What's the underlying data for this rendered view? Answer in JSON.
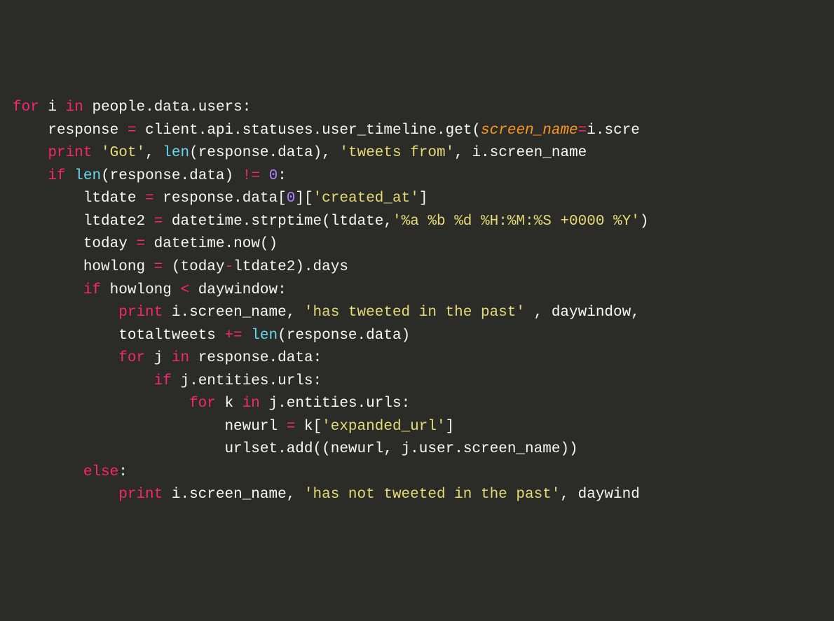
{
  "code": {
    "l1": {
      "kw1": "for",
      "kw2": "in",
      "id1": "i",
      "id2": "people",
      "id3": "data",
      "id4": "users"
    },
    "l2": {
      "id1": "response",
      "id2": "client",
      "id3": "api",
      "id4": "statuses",
      "id5": "user_timeline",
      "id6": "get",
      "param": "screen_name",
      "id7": "i",
      "id8": "scre"
    },
    "l3": {
      "kw": "print",
      "str1": "'Got'",
      "fn": "len",
      "id1": "response",
      "id2": "data",
      "str2": "'tweets from'",
      "id3": "i",
      "id4": "screen_name"
    },
    "l4": {
      "kw": "if",
      "fn": "len",
      "id1": "response",
      "id2": "data",
      "op": "!=",
      "num": "0"
    },
    "l5": {
      "id1": "ltdate",
      "id2": "response",
      "id3": "data",
      "num": "0",
      "str": "'created_at'"
    },
    "l6": {
      "id1": "ltdate2",
      "id2": "datetime",
      "id3": "strptime",
      "id4": "ltdate",
      "str": "'%a %b %d %H:%M:%S +0000 %Y'"
    },
    "l7": {
      "id1": "today",
      "id2": "datetime",
      "id3": "now"
    },
    "l8": {
      "id1": "howlong",
      "id2": "today",
      "id3": "ltdate2",
      "id4": "days"
    },
    "l9": {
      "kw": "if",
      "id1": "howlong",
      "op": "<",
      "id2": "daywindow"
    },
    "l10": {
      "kw": "print",
      "id1": "i",
      "id2": "screen_name",
      "str": "'has tweeted in the past'",
      "id3": "daywindow"
    },
    "l11": {
      "id1": "totaltweets",
      "op": "+=",
      "fn": "len",
      "id2": "response",
      "id3": "data"
    },
    "l12": {
      "kw1": "for",
      "id1": "j",
      "kw2": "in",
      "id2": "response",
      "id3": "data"
    },
    "l13": {
      "kw": "if",
      "id1": "j",
      "id2": "entities",
      "id3": "urls"
    },
    "l14": {
      "kw1": "for",
      "id1": "k",
      "kw2": "in",
      "id2": "j",
      "id3": "entities",
      "id4": "urls"
    },
    "l15": {
      "id1": "newurl",
      "id2": "k",
      "str": "'expanded_url'"
    },
    "l16": {
      "id1": "urlset",
      "id2": "add",
      "id3": "newurl",
      "id4": "j",
      "id5": "user",
      "id6": "screen_name"
    },
    "l17": {
      "kw": "else"
    },
    "l18": {
      "kw": "print",
      "id1": "i",
      "id2": "screen_name",
      "str": "'has not tweeted in the past'",
      "id3": "daywind"
    }
  }
}
